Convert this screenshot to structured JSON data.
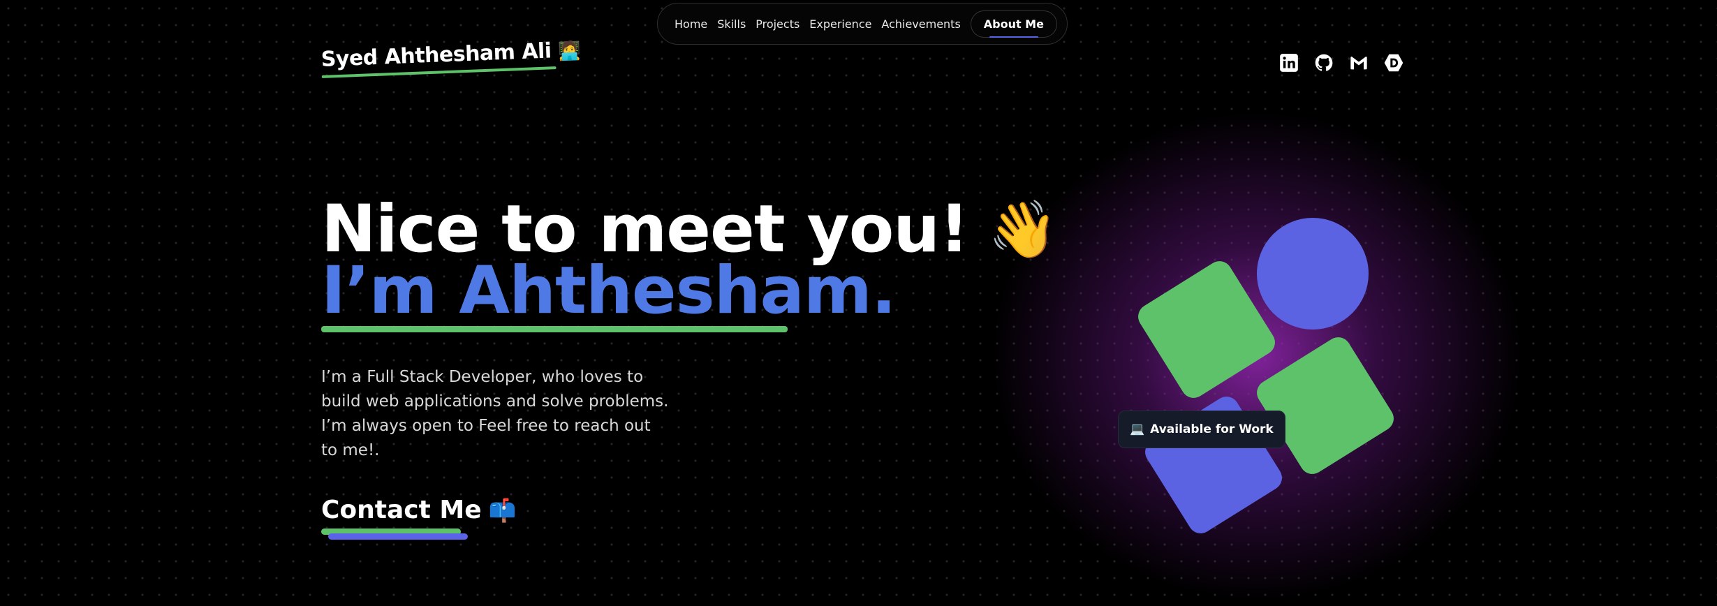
{
  "nav": {
    "items": [
      {
        "label": "Home"
      },
      {
        "label": "Skills"
      },
      {
        "label": "Projects"
      },
      {
        "label": "Experience"
      },
      {
        "label": "Achievements"
      },
      {
        "label": "About Me",
        "active": true
      }
    ]
  },
  "logo": {
    "text": "Syed Ahthesham Ali",
    "emoji": "🧑‍💻"
  },
  "socials": [
    {
      "icon": "linkedin-icon"
    },
    {
      "icon": "github-icon"
    },
    {
      "icon": "gmail-icon"
    },
    {
      "icon": "devpost-icon"
    }
  ],
  "hero": {
    "greeting": "Nice to meet you!",
    "wave_emoji": "👋",
    "name_line": "I’m Ahthesham.",
    "bio": "I’m a Full Stack Developer, who loves to build web applications and solve problems. I’m always open to Feel free to reach out to me!.",
    "contact_label": "Contact Me",
    "contact_emoji": "📫"
  },
  "badge": {
    "emoji": "💻",
    "text": "Available for Work"
  },
  "colors": {
    "background": "#000000",
    "accent_blue": "#4f7ae6",
    "shape_blue": "#5b63e3",
    "accent_green": "#5ec26a",
    "glow_purple": "#9628b4"
  }
}
